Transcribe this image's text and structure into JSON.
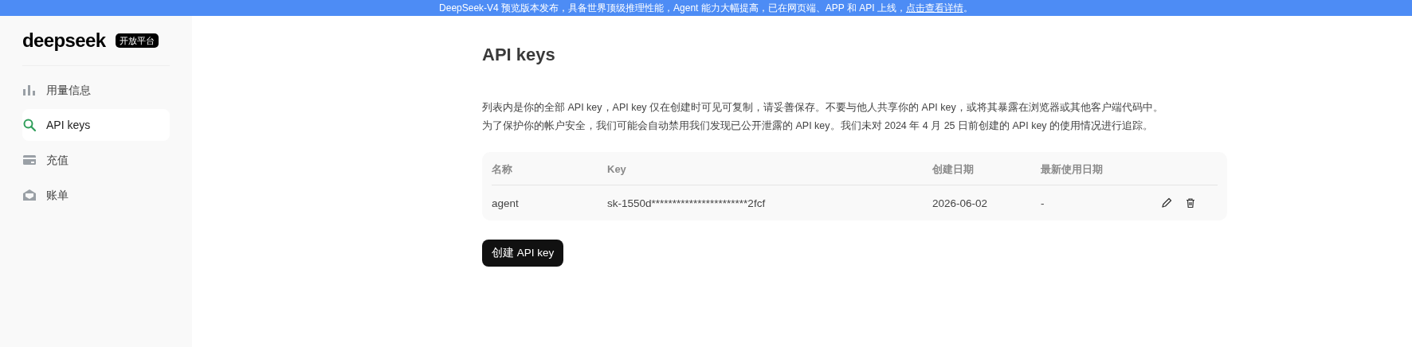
{
  "banner": {
    "text": "DeepSeek-V4 预览版本发布，具备世界顶级推理性能，Agent 能力大幅提高，已在网页端、APP 和 API 上线，",
    "link": "点击查看详情",
    "end": "。"
  },
  "sidebar": {
    "logo": "deepseek",
    "badge": "开放平台",
    "items": [
      {
        "label": "用量信息",
        "selected": false
      },
      {
        "label": "API keys",
        "selected": true
      },
      {
        "label": "充值",
        "selected": false
      },
      {
        "label": "账单",
        "selected": false
      }
    ]
  },
  "page": {
    "title": "API keys",
    "description": [
      "列表内是你的全部 API key，API key 仅在创建时可见可复制，请妥善保存。不要与他人共享你的 API key，或将其暴露在浏览器或其他客户端代码中。",
      "为了保护你的帐户安全，我们可能会自动禁用我们发现已公开泄露的 API key。我们未对 2024 年 4 月 25 日前创建的 API key 的使用情况进行追踪。"
    ]
  },
  "table": {
    "columns": [
      "名称",
      "Key",
      "创建日期",
      "最新使用日期"
    ],
    "rows": [
      {
        "name": "agent",
        "key": "sk-1550d***********************2fcf",
        "created": "2026-06-02",
        "last_used": "-"
      }
    ]
  },
  "create_button": "创建 API key"
}
